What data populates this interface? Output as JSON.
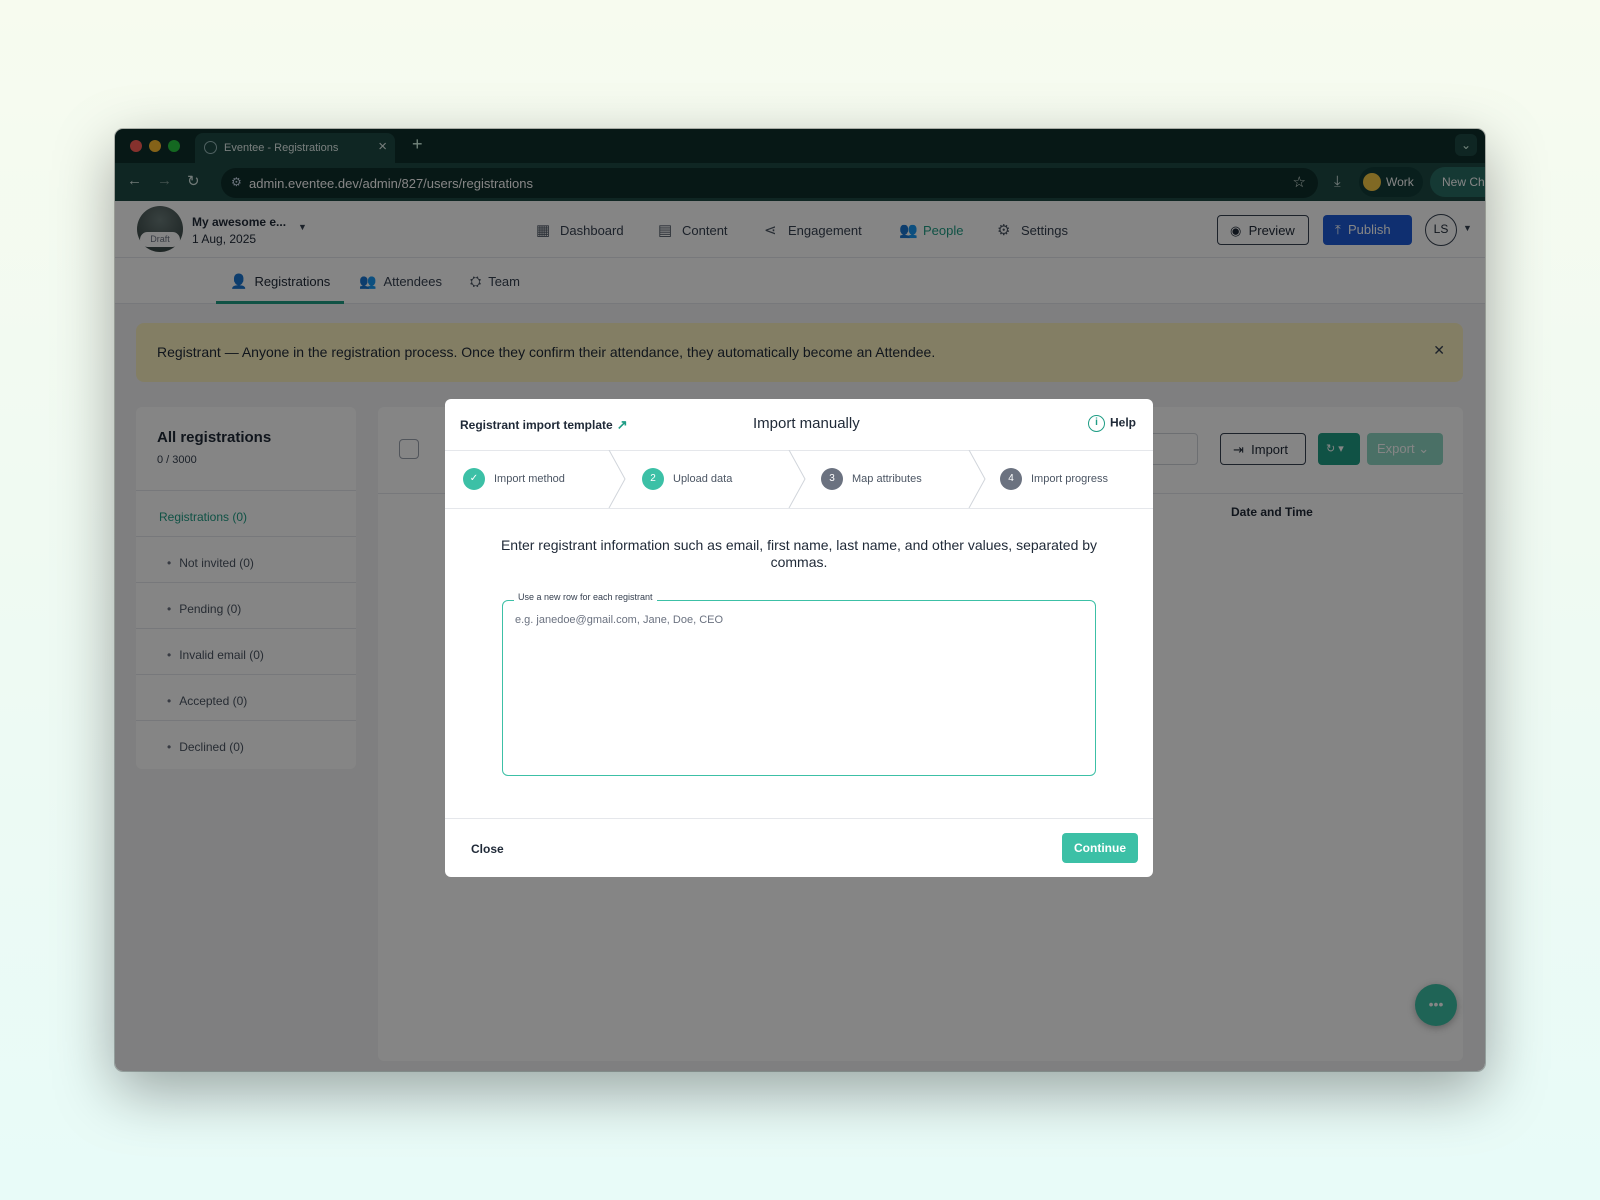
{
  "browser": {
    "tab_title": "Eventee - Registrations",
    "url": "admin.eventee.dev/admin/827/users/registrations",
    "profile_label": "Work",
    "update_label": "New Chrome available"
  },
  "event": {
    "name": "My awesome e...",
    "date": "1 Aug, 2025",
    "status": "Draft"
  },
  "main_nav": {
    "dashboard": "Dashboard",
    "content": "Content",
    "engagement": "Engagement",
    "people": "People",
    "settings": "Settings",
    "active": "People"
  },
  "actions": {
    "preview": "Preview",
    "publish": "Publish",
    "user_initials": "LS"
  },
  "sub_nav": {
    "registrations": "Registrations",
    "attendees": "Attendees",
    "team": "Team",
    "active": "Registrations"
  },
  "banner": {
    "text": "Registrant — Anyone in the registration process. Once they confirm their attendance, they automatically become an Attendee."
  },
  "sidebar": {
    "title": "All registrations",
    "count": "0 / 3000",
    "main_item": "Registrations (0)",
    "items": [
      "Not invited (0)",
      "Pending (0)",
      "Invalid email (0)",
      "Accepted (0)",
      "Declined (0)"
    ]
  },
  "panel": {
    "import_label": "Import",
    "export_label": "Export",
    "column_date": "Date and Time"
  },
  "modal": {
    "template_link": "Registrant import template",
    "title": "Import manually",
    "help": "Help",
    "steps": [
      {
        "number": "✓",
        "label": "Import method",
        "state": "done"
      },
      {
        "number": "2",
        "label": "Upload data",
        "state": "current"
      },
      {
        "number": "3",
        "label": "Map attributes",
        "state": "pending"
      },
      {
        "number": "4",
        "label": "Import progress",
        "state": "pending"
      }
    ],
    "instruction": "Enter registrant information such as email, first name, last name, and other values, separated by commas.",
    "field_label": "Use a new row for each registrant",
    "field_placeholder": "e.g. janedoe@gmail.com, Jane, Doe, CEO",
    "field_value": "",
    "close": "Close",
    "continue": "Continue"
  },
  "colors": {
    "accent": "#3cc0a6",
    "accent_dark": "#1f9d85",
    "publish": "#1e5bd6",
    "chrome_dark": "#0f2e2b",
    "banner": "#fcf1c0"
  }
}
